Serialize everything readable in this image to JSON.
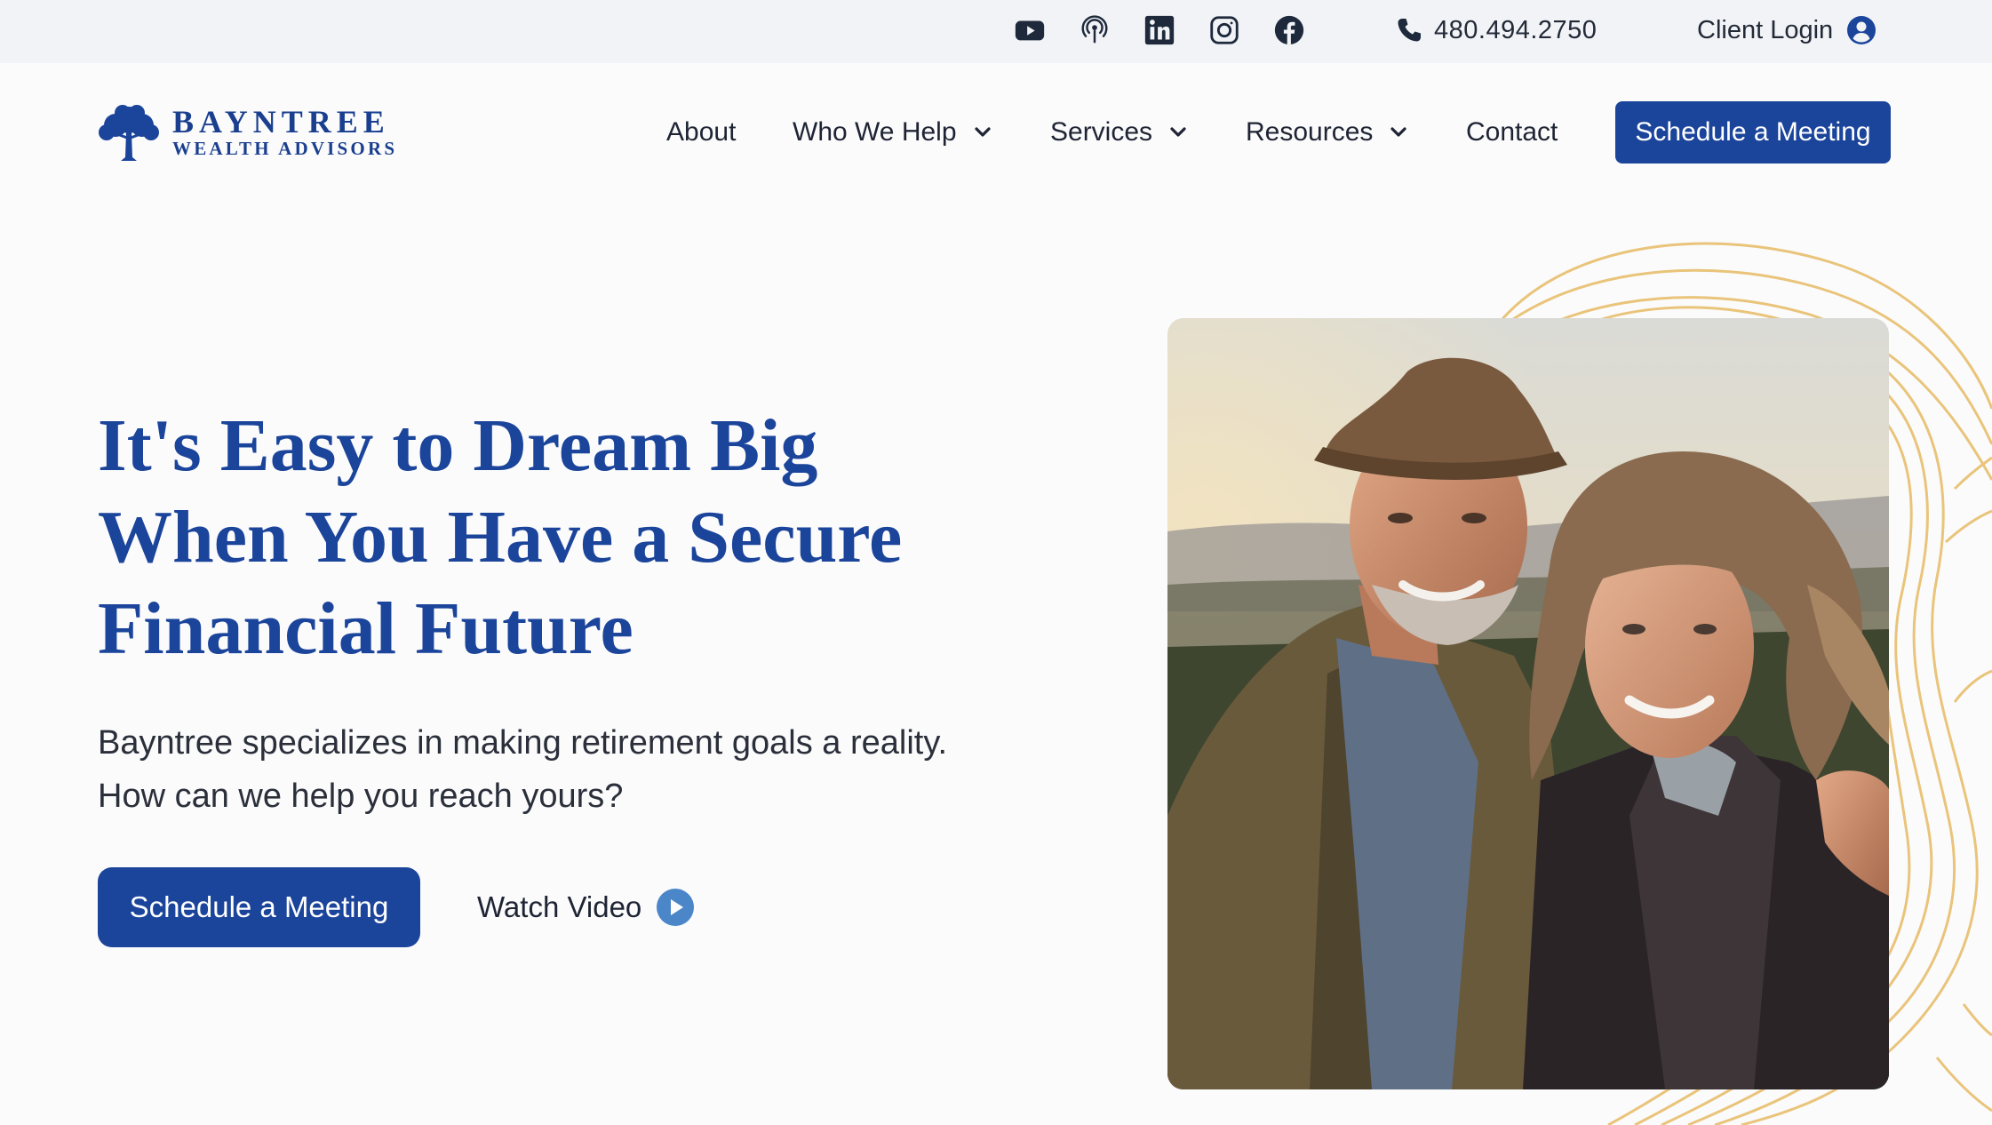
{
  "topbar": {
    "social": [
      "youtube-icon",
      "podcast-icon",
      "linkedin-icon",
      "instagram-icon",
      "facebook-icon"
    ],
    "phone": "480.494.2750",
    "client_login": "Client Login"
  },
  "brand": {
    "name": "BAYNTREE",
    "sub": "WEALTH ADVISORS",
    "color": "#1b449b"
  },
  "nav": {
    "about": "About",
    "who_we_help": "Who We Help",
    "services": "Services",
    "resources": "Resources",
    "contact": "Contact",
    "cta": "Schedule a Meeting"
  },
  "hero": {
    "title_lines": [
      "It's Easy to Dream Big",
      "When You Have a Secure",
      "Financial Future"
    ],
    "subtitle_lines": [
      "Bayntree specializes in making retirement goals a reality.",
      "How can we help you reach yours?"
    ],
    "cta": "Schedule a Meeting",
    "watch_video": "Watch Video"
  },
  "colors": {
    "accent": "#1b449b",
    "play": "#4a86c8",
    "contour": "#e9c47a",
    "topbar_bg": "#f2f3f6"
  }
}
